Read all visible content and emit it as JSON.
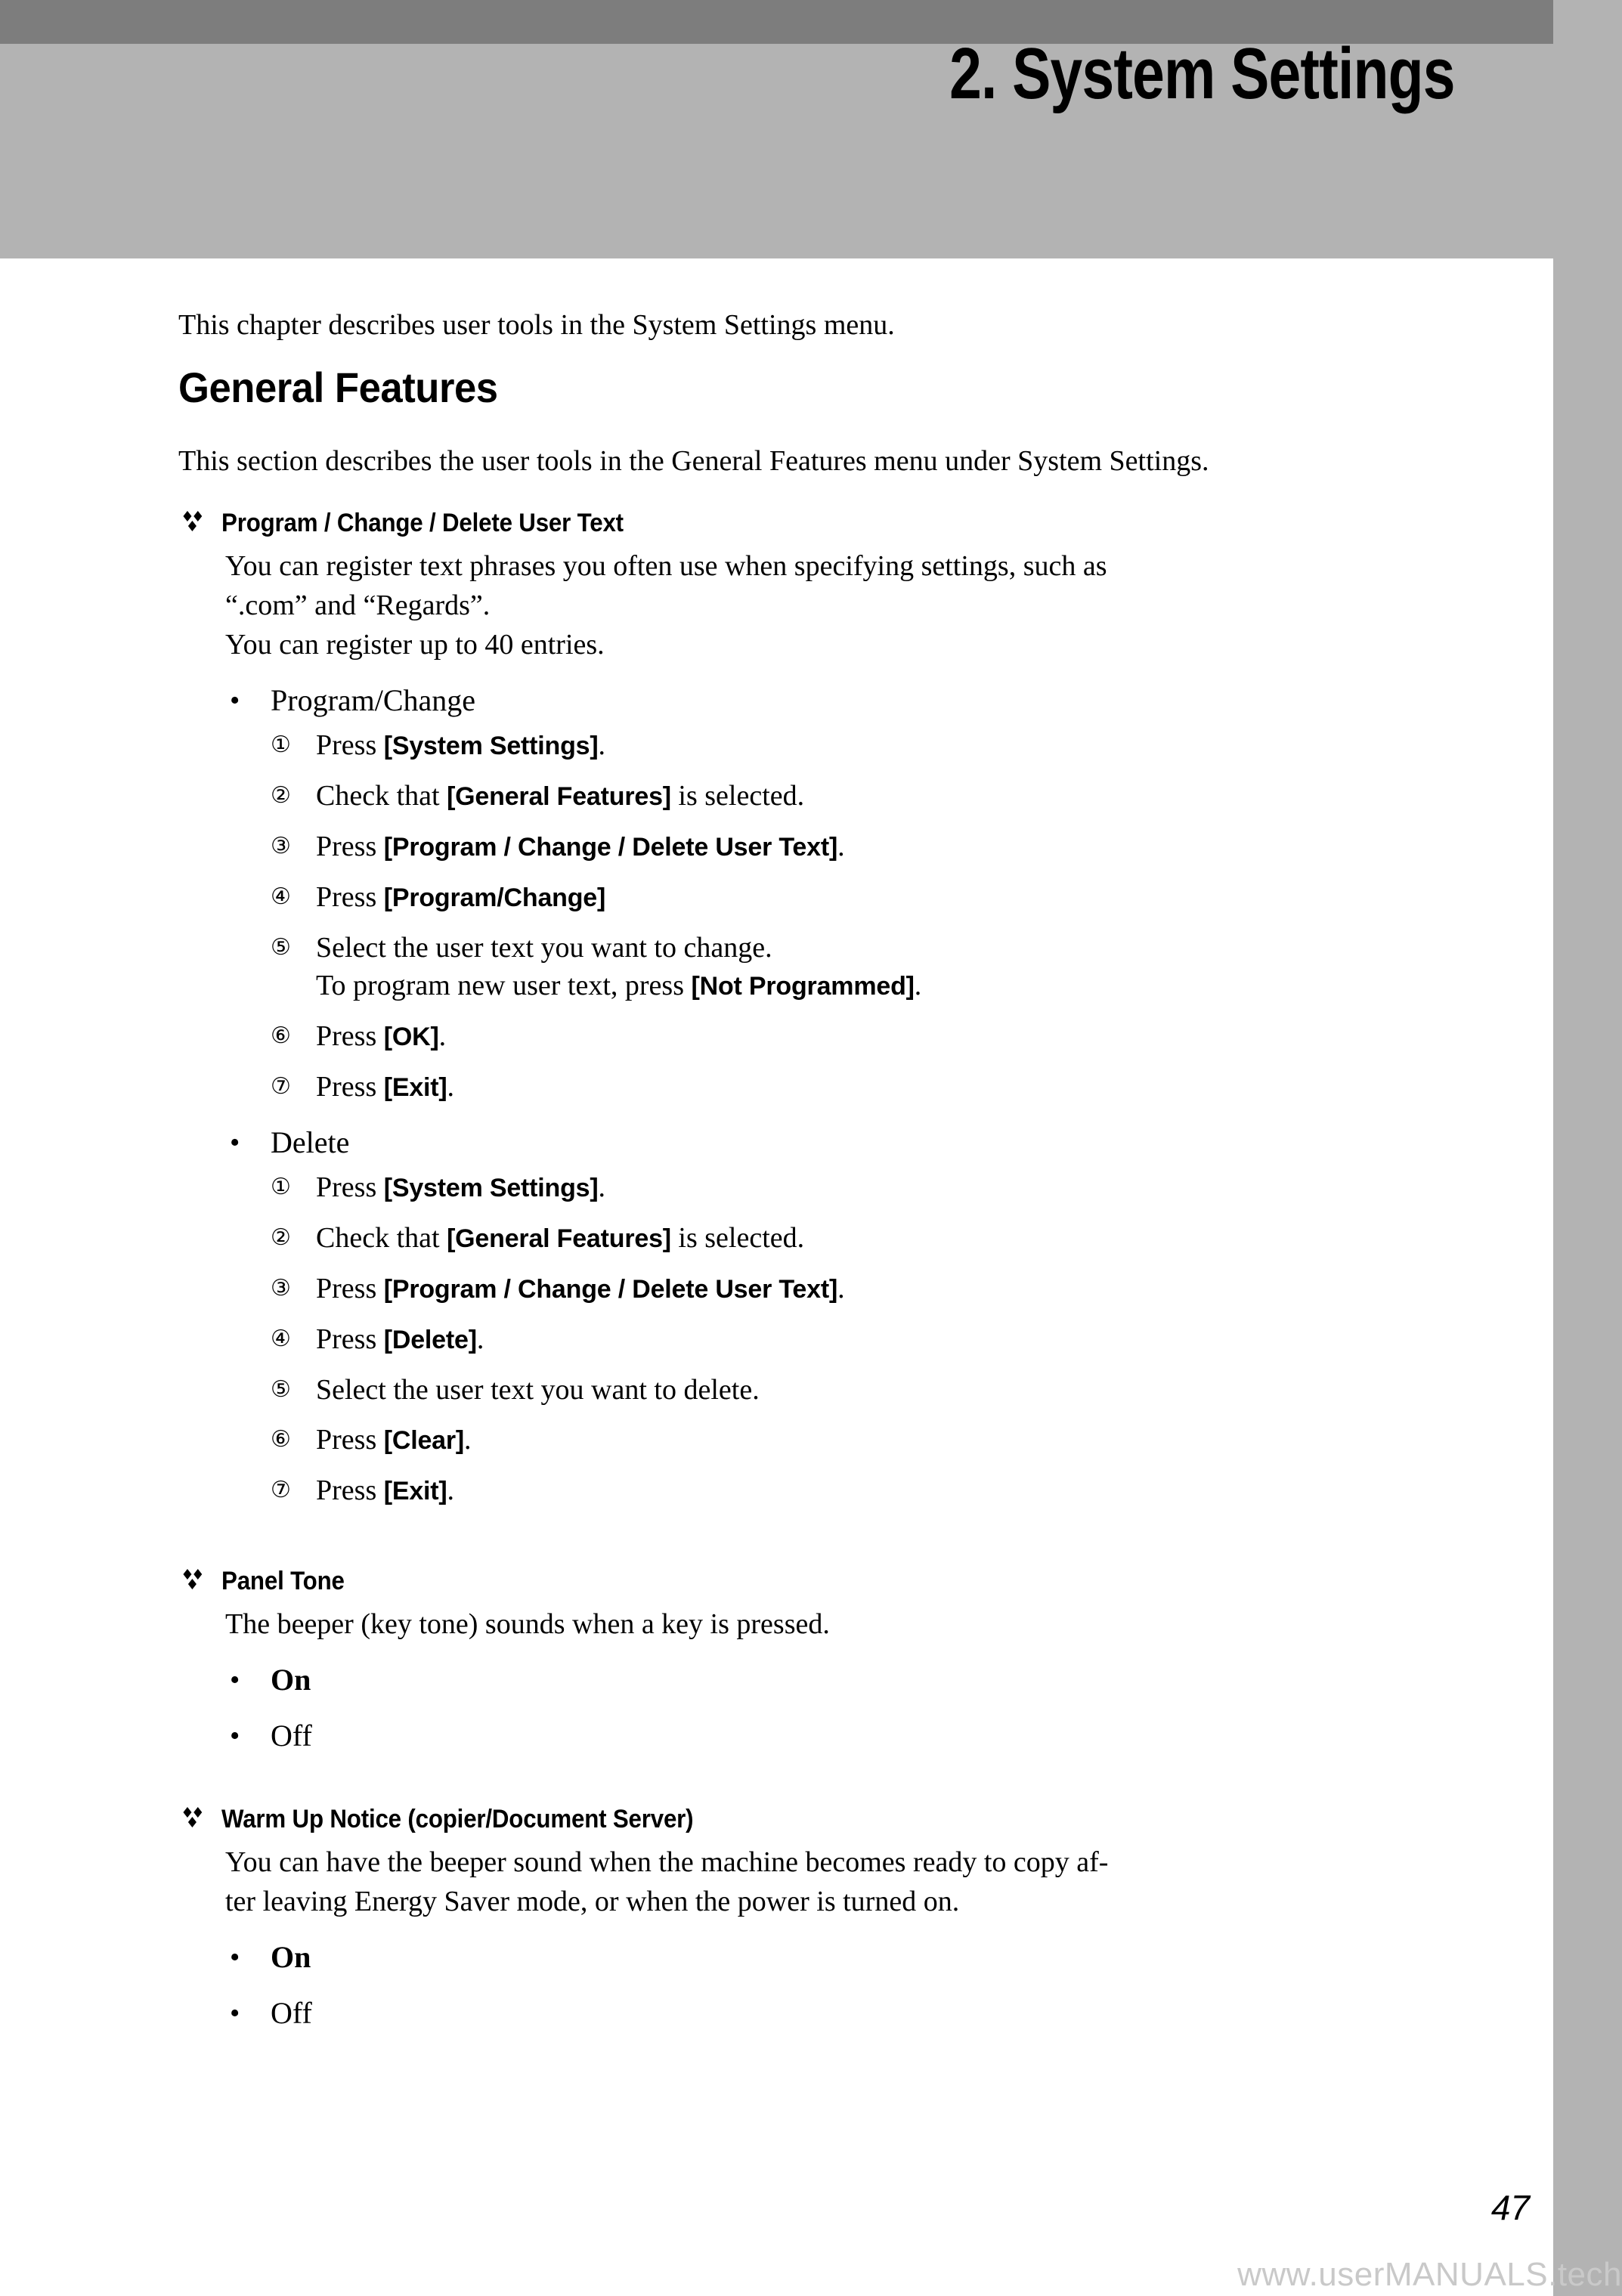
{
  "chapter": {
    "title": "2. System Settings"
  },
  "intro": {
    "paragraph": "This chapter describes user tools in the System Settings menu."
  },
  "section": {
    "heading": "General Features",
    "intro": "This section describes the user tools in the General Features menu under System Settings."
  },
  "features": [
    {
      "name": "Program / Change / Delete User Text",
      "marker": "diamond-bullet-icon",
      "body_lines": [
        "You can register text phrases you often use when specifying settings, such as",
        "“.com” and “Regards”.",
        "You can register up to 40 entries."
      ],
      "subitems": [
        {
          "label": "Program/Change",
          "bold": false,
          "steps": [
            {
              "num": "①",
              "pre": "Press ",
              "key": "[System Settings]",
              "post": ".",
              "sub": ""
            },
            {
              "num": "②",
              "pre": "Check that ",
              "key": "[General Features]",
              "post": " is selected.",
              "sub": ""
            },
            {
              "num": "③",
              "pre": "Press ",
              "key": "[Program / Change / Delete User Text]",
              "post": ".",
              "sub": ""
            },
            {
              "num": "④",
              "pre": "Press ",
              "key": "[Program/Change]",
              "post": "",
              "sub": ""
            },
            {
              "num": "⑤",
              "pre": "Select the user text you want to change.",
              "key": "",
              "post": "",
              "sub": "To program new user text, press ",
              "sub_key": "[Not Programmed]",
              "sub_post": "."
            },
            {
              "num": "⑥",
              "pre": "Press ",
              "key": "[OK]",
              "post": ".",
              "sub": ""
            },
            {
              "num": "⑦",
              "pre": "Press ",
              "key": "[Exit]",
              "post": ".",
              "sub": ""
            }
          ]
        },
        {
          "label": "Delete",
          "bold": false,
          "steps": [
            {
              "num": "①",
              "pre": "Press ",
              "key": "[System Settings]",
              "post": ".",
              "sub": ""
            },
            {
              "num": "②",
              "pre": "Check that ",
              "key": "[General Features]",
              "post": " is selected.",
              "sub": ""
            },
            {
              "num": "③",
              "pre": "Press ",
              "key": "[Program / Change / Delete User Text]",
              "post": ".",
              "sub": ""
            },
            {
              "num": "④",
              "pre": "Press ",
              "key": "[Delete]",
              "post": ".",
              "sub": ""
            },
            {
              "num": "⑤",
              "pre": "Select the user text you want to delete.",
              "key": "",
              "post": "",
              "sub": ""
            },
            {
              "num": "⑥",
              "pre": "Press ",
              "key": "[Clear]",
              "post": ".",
              "sub": ""
            },
            {
              "num": "⑦",
              "pre": "Press ",
              "key": "[Exit]",
              "post": ".",
              "sub": ""
            }
          ]
        }
      ]
    },
    {
      "name": "Panel Tone",
      "marker": "diamond-bullet-icon",
      "body_lines": [
        "The beeper (key tone) sounds when a key is pressed."
      ],
      "options": [
        {
          "label": "On",
          "bold": true
        },
        {
          "label": "Off",
          "bold": false
        }
      ]
    },
    {
      "name": "Warm Up Notice (copier/Document Server)",
      "marker": "diamond-bullet-icon",
      "body_lines": [
        "You can have the beeper sound when the machine becomes ready to copy af-",
        "ter leaving Energy Saver mode, or when the power is turned on."
      ],
      "options": [
        {
          "label": "On",
          "bold": true
        },
        {
          "label": "Off",
          "bold": false
        }
      ]
    }
  ],
  "footer": {
    "page_number": "47",
    "watermark": "www.userMANUALS.tech"
  },
  "colors": {
    "banner_top": "#7d7d7d",
    "banner_body": "#b3b3b3",
    "edge_strip": "#b3b3b3",
    "watermark": "#c9c9c9"
  }
}
